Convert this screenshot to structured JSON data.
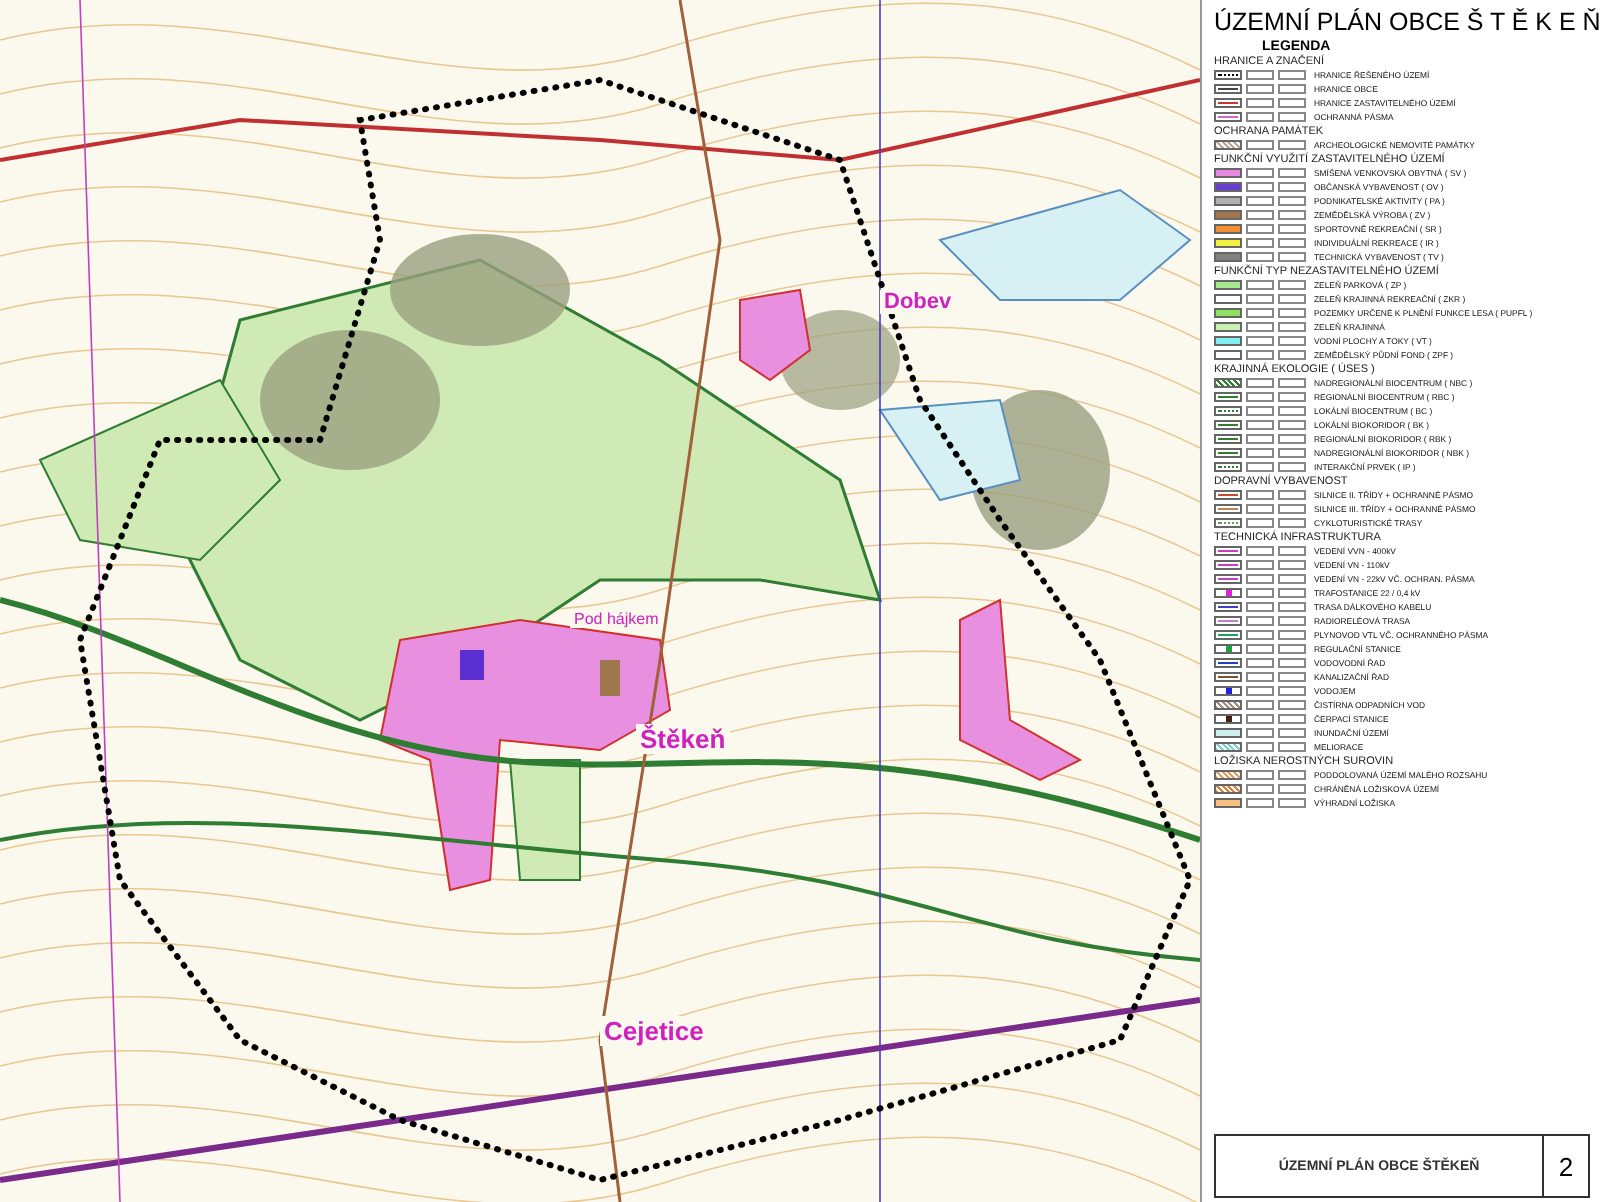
{
  "map": {
    "places": [
      {
        "name": "Dobev",
        "kind": "village"
      },
      {
        "name": "Pod hájkem",
        "kind": "locality"
      },
      {
        "name": "Štěkeň",
        "kind": "town"
      },
      {
        "name": "Cejetice",
        "kind": "town"
      }
    ]
  },
  "legend": {
    "title": "ÚZEMNÍ PLÁN OBCE  Š T Ě K E Ň",
    "heading": "LEGENDA",
    "sections": [
      {
        "title": "HRANICE A ZNAČENÍ",
        "items": [
          {
            "label": "HRANICE ŘEŠENÉHO ÚZEMÍ",
            "kind": "dots",
            "color": "#000000"
          },
          {
            "label": "HRANICE OBCE",
            "kind": "line",
            "color": "#444444"
          },
          {
            "label": "HRANICE ZASTAVITELNÉHO ÚZEMÍ",
            "kind": "line",
            "color": "#cc3333"
          },
          {
            "label": "OCHRANNÁ PÁSMA",
            "kind": "line",
            "color": "#cc66cc"
          }
        ]
      },
      {
        "title": "OCHRANA PAMÁTEK",
        "items": [
          {
            "label": "ARCHEOLOGICKÉ NEMOVITÉ PAMÁTKY",
            "kind": "hatch",
            "color": "#b8a8a0"
          }
        ]
      },
      {
        "title": "FUNKČNÍ VYUŽITÍ ZASTAVITELNÉHO ÚZEMÍ",
        "items": [
          {
            "label": "SMÍŠENÁ VENKOVSKÁ OBYTNÁ ( SV )",
            "kind": "fill",
            "color": "#e68ae0"
          },
          {
            "label": "OBČANSKÁ VYBAVENOST ( OV )",
            "kind": "fill",
            "color": "#6a3fd0"
          },
          {
            "label": "PODNIKATELSKÉ AKTIVITY ( PA )",
            "kind": "fill",
            "color": "#b0b0b0"
          },
          {
            "label": "ZEMĚDĚLSKÁ VÝROBA ( ZV )",
            "kind": "fill",
            "color": "#a07850"
          },
          {
            "label": "SPORTOVNĚ REKREAČNÍ ( SR )",
            "kind": "fill",
            "color": "#f09030"
          },
          {
            "label": "INDIVIDUÁLNÍ REKREACE ( IR )",
            "kind": "fill",
            "color": "#f4f040"
          },
          {
            "label": "TECHNICKÁ VYBAVENOST ( TV )",
            "kind": "fill",
            "color": "#808080"
          }
        ]
      },
      {
        "title": "FUNKČNÍ TYP NEZASTAVITELNÉHO ÚZEMÍ",
        "items": [
          {
            "label": "ZELEŇ PARKOVÁ ( ZP )",
            "kind": "fill",
            "color": "#a8e890"
          },
          {
            "label": "ZELEŇ KRAJINNÁ REKREAČNÍ ( ZKR )",
            "kind": "fill",
            "color": "#ffffff"
          },
          {
            "label": "POZEMKY URČENÉ K PLNĚNÍ FUNKCE LESA ( PUPFL )",
            "kind": "fill",
            "color": "#90e060"
          },
          {
            "label": "ZELEŇ KRAJINNÁ",
            "kind": "fill",
            "color": "#c8f0b0"
          },
          {
            "label": "VODNÍ PLOCHY A TOKY ( VT )",
            "kind": "fill",
            "color": "#80f0f0"
          },
          {
            "label": "ZEMĚDĚLSKÝ PŮDNÍ FOND ( ZPF )",
            "kind": "fill",
            "color": "#ffffff"
          }
        ]
      },
      {
        "title": "KRAJINNÁ EKOLOGIE ( ÚSES )",
        "items": [
          {
            "label": "NADREGIONÁLNÍ BIOCENTRUM ( NBC )",
            "kind": "hatch",
            "color": "#2e7d32"
          },
          {
            "label": "REGIONÁLNÍ BIOCENTRUM ( RBC )",
            "kind": "line",
            "color": "#2e7d32"
          },
          {
            "label": "LOKÁLNÍ BIOCENTRUM ( BC )",
            "kind": "dots",
            "color": "#2e7d32"
          },
          {
            "label": "LOKÁLNÍ BIOKORIDOR ( BK )",
            "kind": "line",
            "color": "#2e7d32"
          },
          {
            "label": "REGIONÁLNÍ BIOKORIDOR ( RBK )",
            "kind": "line",
            "color": "#2e7d32"
          },
          {
            "label": "NADREGIONÁLNÍ BIOKORIDOR ( NBK )",
            "kind": "line",
            "color": "#2e7d32"
          },
          {
            "label": "INTERAKČNÍ PRVEK ( IP )",
            "kind": "dots",
            "color": "#2e7d32"
          }
        ]
      },
      {
        "title": "DOPRAVNÍ VYBAVENOST",
        "items": [
          {
            "label": "SILNICE II. TŘÍDY + OCHRANNÉ PÁSMO",
            "kind": "line",
            "color": "#c05030"
          },
          {
            "label": "SILNICE III. TŘÍDY + OCHRANNÉ PÁSMO",
            "kind": "line",
            "color": "#c08050"
          },
          {
            "label": "CYKLOTURISTICKÉ TRASY",
            "kind": "dots",
            "color": "#60a060"
          }
        ]
      },
      {
        "title": "TECHNICKÁ INFRASTRUKTURA",
        "items": [
          {
            "label": "VEDENÍ VVN - 400kV",
            "kind": "line",
            "color": "#c040c0"
          },
          {
            "label": "VEDENÍ VN - 110kV",
            "kind": "line",
            "color": "#c040c0"
          },
          {
            "label": "VEDENÍ VN - 22kV VČ. OCHRAN. PÁSMA",
            "kind": "line",
            "color": "#c040c0"
          },
          {
            "label": "TRAFOSTANICE 22 / 0,4 kV",
            "kind": "dot",
            "color": "#e020e0"
          },
          {
            "label": "TRASA DÁLKOVÉHO KABELU",
            "kind": "line",
            "color": "#4040c0"
          },
          {
            "label": "RADIORELÉOVÁ TRASA",
            "kind": "line",
            "color": "#c080c0"
          },
          {
            "label": "PLYNOVOD VTL VČ. OCHRANNÉHO PÁSMA",
            "kind": "line",
            "color": "#20a060"
          },
          {
            "label": "REGULAČNÍ STANICE",
            "kind": "dot",
            "color": "#20a040"
          },
          {
            "label": "VODOVODNÍ ŘAD",
            "kind": "line",
            "color": "#2040c0"
          },
          {
            "label": "KANALIZAČNÍ ŘAD",
            "kind": "line",
            "color": "#805030"
          },
          {
            "label": "VODOJEM",
            "kind": "dot",
            "color": "#2020e0"
          },
          {
            "label": "ČISTÍRNA ODPADNÍCH VOD",
            "kind": "hatch",
            "color": "#a09080"
          },
          {
            "label": "ČERPACÍ STANICE",
            "kind": "dot",
            "color": "#402010"
          },
          {
            "label": "INUNDAČNÍ ÚZEMÍ",
            "kind": "fill",
            "color": "#d0f0f0"
          },
          {
            "label": "MELIORACE",
            "kind": "hatch",
            "color": "#80d0d0"
          }
        ]
      },
      {
        "title": "LOŽISKA NEROSTNÝCH SUROVIN",
        "items": [
          {
            "label": "PODDOLOVANÁ ÚZEMÍ MALÉHO ROZSAHU",
            "kind": "hatch",
            "color": "#e0a060"
          },
          {
            "label": "CHRÁNĚNÁ LOŽISKOVÁ ÚZEMÍ",
            "kind": "hatch",
            "color": "#e08040"
          },
          {
            "label": "VÝHRADNÍ LOŽISKA",
            "kind": "fill",
            "color": "#f8c080"
          }
        ]
      }
    ]
  },
  "stamp": {
    "title": "ÚZEMNÍ PLÁN OBCE ŠTĚKEŇ",
    "sheet": "2"
  }
}
